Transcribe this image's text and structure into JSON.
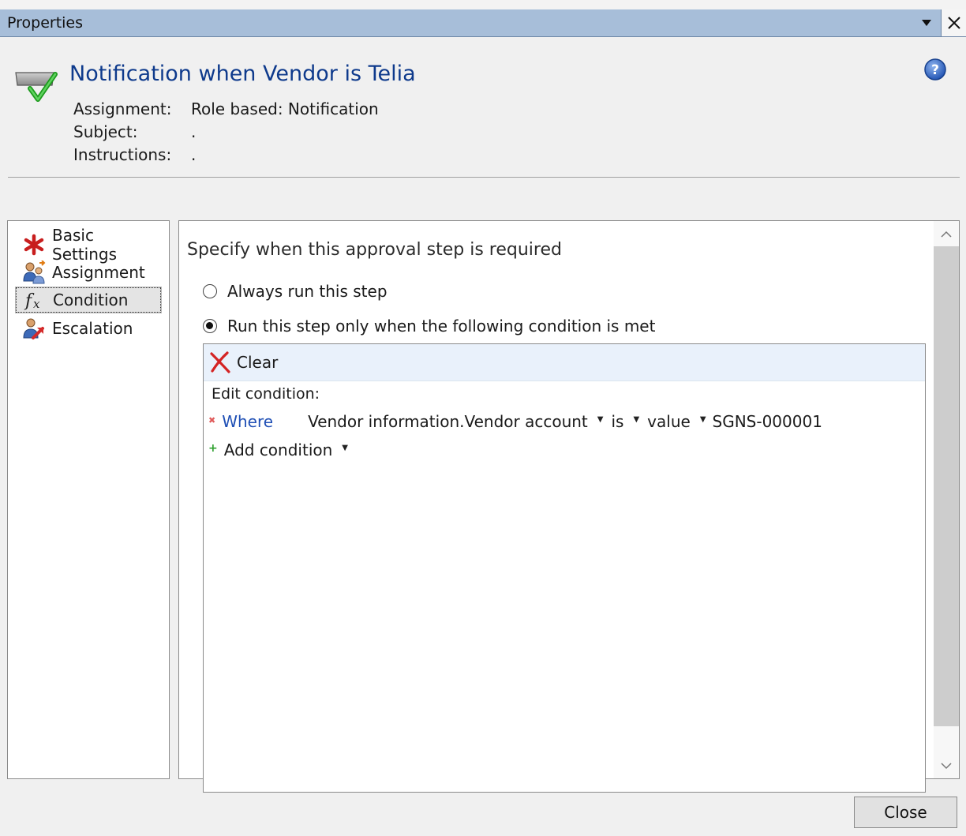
{
  "window": {
    "title": "Properties"
  },
  "header": {
    "title": "Notification when Vendor is Telia",
    "assignment_label": "Assignment:",
    "assignment_value": "Role based: Notification",
    "subject_label": "Subject:",
    "subject_value": ".",
    "instructions_label": "Instructions:",
    "instructions_value": "."
  },
  "nav": {
    "items": [
      {
        "label": "Basic Settings",
        "icon": "required-asterisk-icon"
      },
      {
        "label": "Assignment",
        "icon": "users-assignment-icon"
      },
      {
        "label": "Condition",
        "icon": "function-fx-icon",
        "selected": true
      },
      {
        "label": "Escalation",
        "icon": "escalation-user-icon"
      }
    ]
  },
  "main": {
    "heading": "Specify when this approval step is required",
    "options": [
      {
        "label": "Always run this step",
        "checked": false
      },
      {
        "label": "Run this step only when the following condition is met",
        "checked": true
      }
    ],
    "condition": {
      "clear_label": "Clear",
      "edit_label": "Edit condition:",
      "where_label": "Where",
      "field": "Vendor information.Vendor account",
      "operator": "is",
      "value_type": "value",
      "value": "SGNS-000001",
      "add_label": "Add condition"
    }
  },
  "footer": {
    "close_label": "Close"
  },
  "colors": {
    "titlebar": "#a7bed9",
    "title_text": "#0e3a8c",
    "link": "#1f4fb5",
    "toolbar": "#e9f1fb"
  }
}
